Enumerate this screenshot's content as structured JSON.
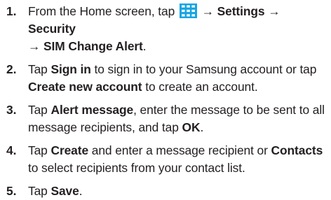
{
  "steps": [
    {
      "number": "1.",
      "t1": "From the Home screen, tap ",
      "icon": "apps-grid-icon",
      "arrow1": " → Settings → Security",
      "arrow2": "→ SIM Change Alert",
      "t2": "."
    },
    {
      "number": "2.",
      "t1": "Tap ",
      "b1": "Sign in",
      "t2": " to sign in to your Samsung account or tap",
      "b2": "Create new account",
      "t3": " to create an account."
    },
    {
      "number": "3.",
      "t1": "Tap ",
      "b1": "Alert message",
      "t2": ", enter the message to be sent to all message recipients, and tap ",
      "b2": "OK",
      "t3": "."
    },
    {
      "number": "4.",
      "t1": "Tap ",
      "b1": "Create",
      "t2": " and enter a message recipient or ",
      "b2": "Contacts",
      "t3": " to select recipients from your contact list."
    },
    {
      "number": "5.",
      "t1": "Tap ",
      "b1": "Save",
      "t2": "."
    }
  ],
  "colors": {
    "icon_fill": "#17a5e2",
    "text": "#231f20"
  }
}
